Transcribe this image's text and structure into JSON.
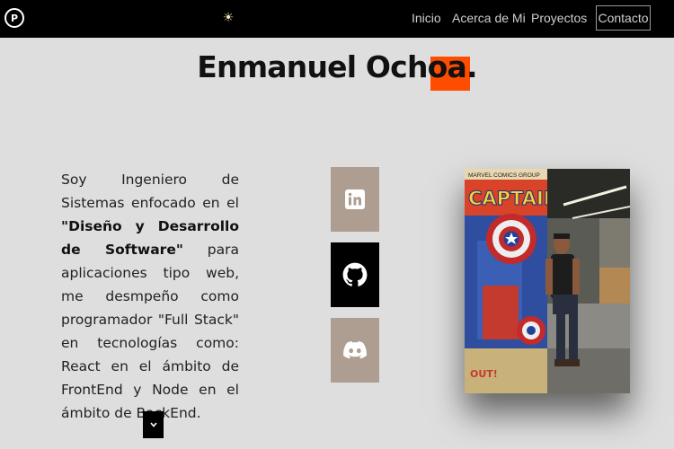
{
  "nav": {
    "logo_letter": "P",
    "theme_icon": "sun-icon",
    "links": [
      "Inicio",
      "Acerca de Mi",
      "Proyectos"
    ],
    "contact": "Contacto"
  },
  "hero": {
    "name_main": "Enmanuel Ochoa",
    "name_dot": "."
  },
  "bio": {
    "part1": "Soy Ingeniero de Sistemas enfocado en el ",
    "highlight": "\"Diseño y Desarrollo de Software\"",
    "part2": " para aplicaciones tipo web, me desmpeño como programador \"Full Stack\" en tecnologías como: React en el ámbito de FrontEnd y Node en el ámbito de BackEnd."
  },
  "social": [
    {
      "icon": "linkedin-icon",
      "color": "#ad9e91"
    },
    {
      "icon": "github-icon",
      "color": "#000000"
    },
    {
      "icon": "discord-icon",
      "color": "#ad9e91"
    }
  ],
  "photo": {
    "poster_top": "MARVEL COMICS GROUP",
    "poster_title": "CAPTAIN",
    "poster_bottom": "OUT!"
  }
}
